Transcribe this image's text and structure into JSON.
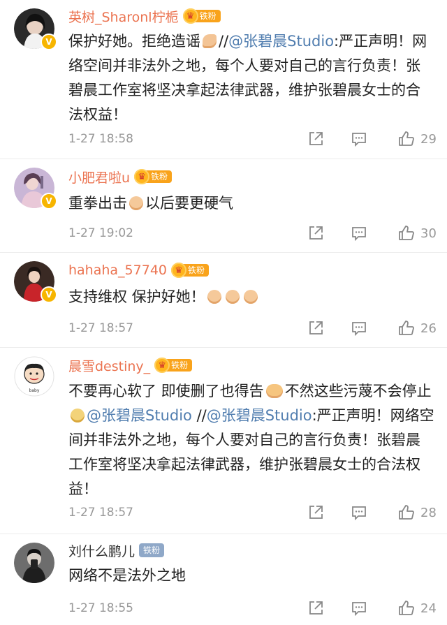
{
  "comments": [
    {
      "username": "英树_Sharonl柠栀",
      "fan_label": "铁粉",
      "text_parts": [
        "保护好她。拒绝造谣",
        "//",
        "@张碧晨Studio",
        ":严正声明！网络空间并非法外之地，每个人要对自己的言行负责！张碧晨工作室将坚决拿起法律武器，维护张碧晨女士的合法权益！"
      ],
      "time": "1-27 18:58",
      "likes": "29"
    },
    {
      "username": "小肥君啦u",
      "fan_label": "铁粉",
      "text_parts": [
        "重拳出击",
        "以后要更硬气"
      ],
      "time": "1-27 19:02",
      "likes": "30"
    },
    {
      "username": "hahaha_57740",
      "fan_label": "铁粉",
      "text_parts": [
        "支持维权  保护好她！"
      ],
      "time": "1-27 18:57",
      "likes": "26"
    },
    {
      "username": "晨雪destiny_",
      "fan_label": "铁粉",
      "text_parts": [
        "不要再心软了 即使删了也得告",
        "不然这些污蔑不会停止",
        "@张碧晨Studio",
        " //",
        "@张碧晨Studio",
        ":严正声明！网络空间并非法外之地，每个人要对自己的言行负责！张碧晨工作室将坚决拿起法律武器，维护张碧晨女士的合法权益！"
      ],
      "time": "1-27 18:57",
      "likes": "28"
    },
    {
      "username": "刘什么鹏儿",
      "fan_label": "铁粉",
      "text_parts": [
        "网络不是法外之地"
      ],
      "time": "1-27 18:55",
      "likes": "24"
    }
  ],
  "icons": {
    "verified": "verified-v-icon",
    "crown": "crown-icon",
    "share": "share-icon",
    "reply": "reply-icon",
    "like": "like-icon"
  },
  "colors": {
    "username": "#eb7350",
    "link": "#507daf",
    "meta": "#999999",
    "fan_badge": "#f9a31b",
    "verified": "#f7b500"
  }
}
